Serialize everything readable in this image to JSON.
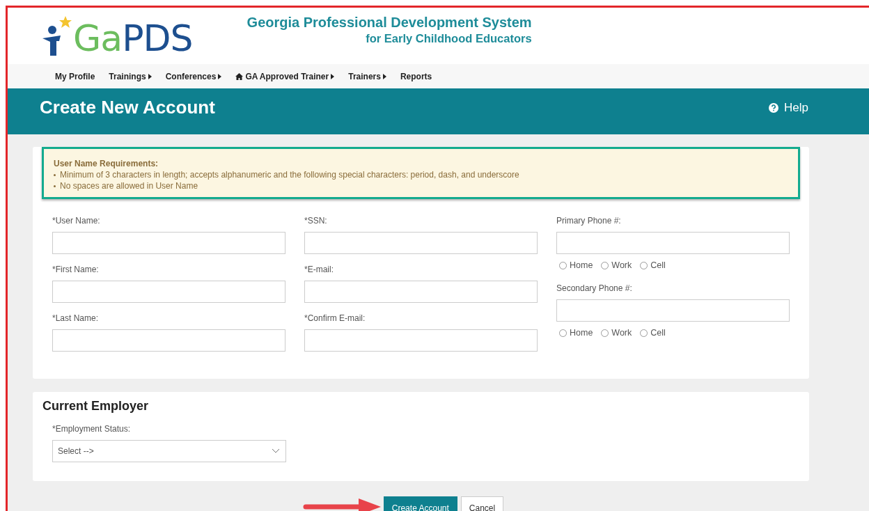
{
  "header": {
    "logo": {
      "part_green": "Ga",
      "part_blue": "PDS"
    },
    "title": "Georgia Professional Development System",
    "subtitle": "for Early Childhood Educators"
  },
  "nav": [
    {
      "label": "My Profile",
      "submenu": false,
      "kind": "plain"
    },
    {
      "label": "Trainings",
      "submenu": true,
      "kind": "plain"
    },
    {
      "label": "Conferences",
      "submenu": true,
      "kind": "plain"
    },
    {
      "label": "GA Approved Trainer",
      "submenu": true,
      "kind": "home"
    },
    {
      "label": "Trainers",
      "submenu": true,
      "kind": "plain"
    },
    {
      "label": "Reports",
      "submenu": false,
      "kind": "plain"
    }
  ],
  "page_title": "Create New Account",
  "help": "Help",
  "requirements": {
    "title": "User Name Requirements:",
    "items": [
      "Minimum of 3 characters in length; accepts alphanumeric and the following special characters: period, dash, and underscore",
      "No spaces are allowed in User Name"
    ]
  },
  "columns": [
    [
      {
        "kind": "input",
        "label": "*User Name:"
      },
      {
        "kind": "input",
        "label": "*First Name:"
      },
      {
        "kind": "input",
        "label": "*Last Name:"
      }
    ],
    [
      {
        "kind": "input",
        "label": "*SSN:"
      },
      {
        "kind": "input",
        "label": "*E-mail:"
      },
      {
        "kind": "input",
        "label": "*Confirm E-mail:"
      }
    ],
    [
      {
        "kind": "phone",
        "label": "Primary Phone #:",
        "options": [
          {
            "label": "Home",
            "selected": false
          },
          {
            "label": "Work",
            "selected": false
          },
          {
            "label": "Cell",
            "selected": false
          }
        ]
      },
      {
        "kind": "phone",
        "label": "Secondary Phone #:",
        "options": [
          {
            "label": "Home",
            "selected": false
          },
          {
            "label": "Work",
            "selected": false
          },
          {
            "label": "Cell",
            "selected": false
          }
        ]
      }
    ]
  ],
  "employer": {
    "title": "Current Employer",
    "label": "*Employment Status:",
    "value": "Select -->"
  },
  "buttons": [
    {
      "label": "Create Account",
      "kind": "primary"
    },
    {
      "label": "Cancel",
      "kind": "secondary"
    }
  ]
}
